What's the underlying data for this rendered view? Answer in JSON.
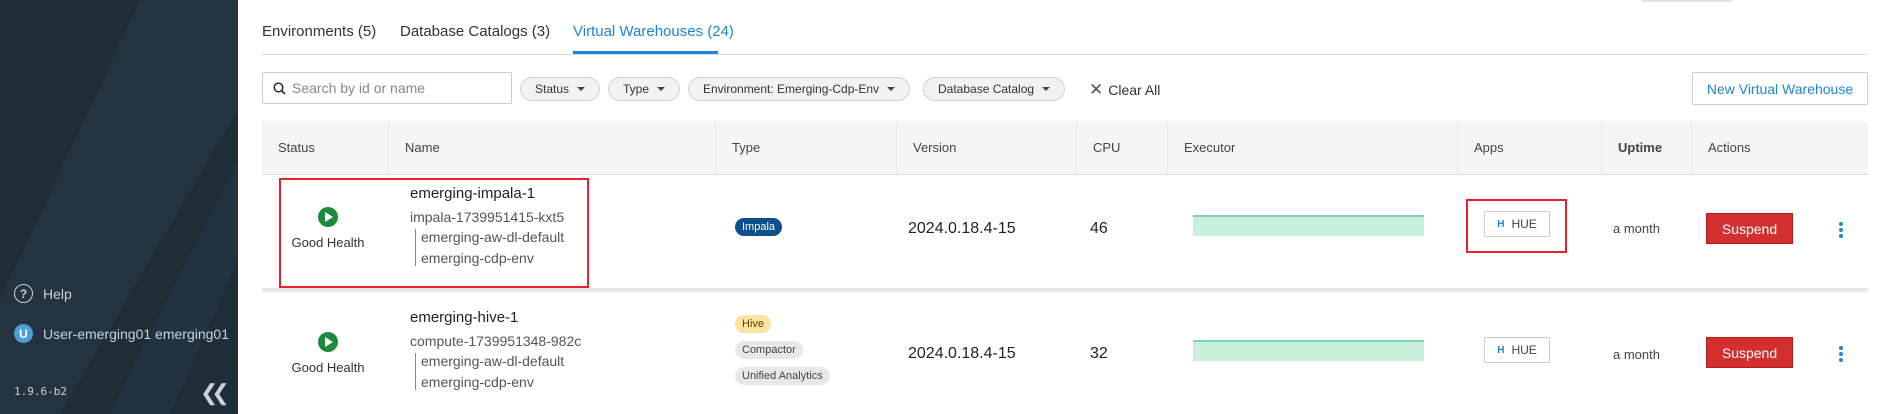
{
  "sidebar": {
    "help_label": "Help",
    "user_initial": "U",
    "user_label": "User-emerging01 emerging01",
    "version": "1.9.6-b2",
    "collapse_icon": "double-chevron-left-icon"
  },
  "tabs": [
    {
      "label": "Environments (5)"
    },
    {
      "label": "Database Catalogs (3)"
    },
    {
      "label": "Virtual Warehouses (24)",
      "active": true
    }
  ],
  "filters": {
    "search_placeholder": "Search by id or name",
    "chips": [
      "Status",
      "Type",
      "Environment: Emerging-Cdp-Env",
      "Database Catalog"
    ],
    "clear_all": "Clear All",
    "new_button": "New Virtual Warehouse"
  },
  "table": {
    "headers": [
      "Status",
      "Name",
      "Type",
      "Version",
      "CPU",
      "Executor",
      "Apps",
      "Uptime",
      "Actions"
    ],
    "rows": [
      {
        "status": "Good Health",
        "name": "emerging-impala-1",
        "id": "impala-1739951415-kxt5",
        "data_lake": "emerging-aw-dl-default",
        "environment": "emerging-cdp-env",
        "types": [
          "Impala"
        ],
        "version": "2024.0.18.4-15",
        "cpu": "46",
        "app": "HUE",
        "uptime": "a month",
        "action": "Suspend"
      },
      {
        "status": "Good Health",
        "name": "emerging-hive-1",
        "id": "compute-1739951348-982c",
        "data_lake": "emerging-aw-dl-default",
        "environment": "emerging-cdp-env",
        "types": [
          "Hive",
          "Compactor",
          "Unified Analytics"
        ],
        "version": "2024.0.18.4-15",
        "cpu": "32",
        "app": "HUE",
        "uptime": "a month",
        "action": "Suspend"
      }
    ]
  },
  "colors": {
    "accent": "#1f85d6",
    "danger": "#d32f2f",
    "healthy": "#1d8a3c",
    "sidebar_bg": "#1f2d36",
    "highlight": "#e8202a"
  }
}
